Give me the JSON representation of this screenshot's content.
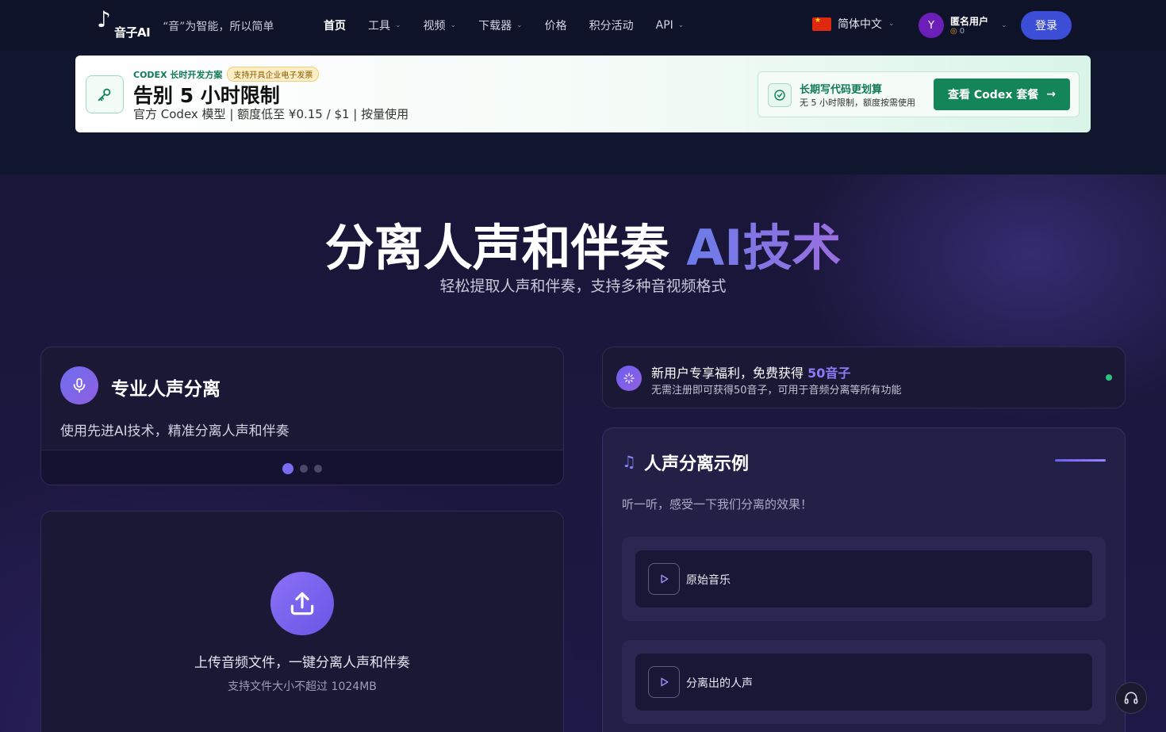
{
  "nav": {
    "brand": "音子AI",
    "slogan": "“音”为智能，所以简单",
    "items": [
      {
        "label": "首页",
        "active": true,
        "dropdown": false
      },
      {
        "label": "工具",
        "active": false,
        "dropdown": true
      },
      {
        "label": "视频",
        "active": false,
        "dropdown": true
      },
      {
        "label": "下载器",
        "active": false,
        "dropdown": true
      },
      {
        "label": "价格",
        "active": false,
        "dropdown": false
      },
      {
        "label": "积分活动",
        "active": false,
        "dropdown": false
      },
      {
        "label": "API",
        "active": false,
        "dropdown": true
      }
    ],
    "language": "简体中文",
    "user": {
      "avatar_letter": "Y",
      "name": "匿名用户",
      "points": "0"
    },
    "login_label": "登录"
  },
  "banner": {
    "tag": "CODEX 长时开发方案",
    "badge": "支持开具企业电子发票",
    "title": "告别 5 小时限制",
    "subtitle": "官方 Codex 模型 | 额度低至 ¥0.15 / $1 | 按量使用",
    "right_title": "长期写代码更划算",
    "right_sub": "无 5 小时限制，额度按需使用",
    "cta": "查看 Codex 套餐"
  },
  "hero": {
    "title_main": "分离人声和伴奏 ",
    "title_accent": "AI技术",
    "subtitle": "轻松提取人声和伴奏，支持多种音视频格式"
  },
  "feature": {
    "title": "专业人声分离",
    "desc": "使用先进AI技术，精准分离人声和伴奏",
    "slides": 3,
    "active_slide": 1
  },
  "upload": {
    "title": "上传音频文件，一键分离人声和伴奏",
    "sub": "支持文件大小不超过 1024MB"
  },
  "promo": {
    "title_prefix": "新用户专享福利，免费获得 ",
    "title_highlight": "50音子",
    "sub": "无需注册即可获得50音子，可用于音频分离等所有功能"
  },
  "demo": {
    "title": "人声分离示例",
    "desc": "听一听，感受一下我们分离的效果！",
    "tracks": [
      {
        "label": "原始音乐"
      },
      {
        "label": "分离出的人声"
      }
    ]
  },
  "colors": {
    "accent": "#7a6cf0",
    "login": "#3d4ed6",
    "codex_green": "#138558",
    "online": "#2ec27e"
  },
  "icons": {
    "banner": "key-icon",
    "banner_right": "check-circle-icon",
    "feature": "microphone-icon",
    "upload": "upload-icon",
    "promo": "sparkle-icon",
    "demo": "music-note-icon",
    "track": "play-icon",
    "support": "headphones-icon"
  }
}
